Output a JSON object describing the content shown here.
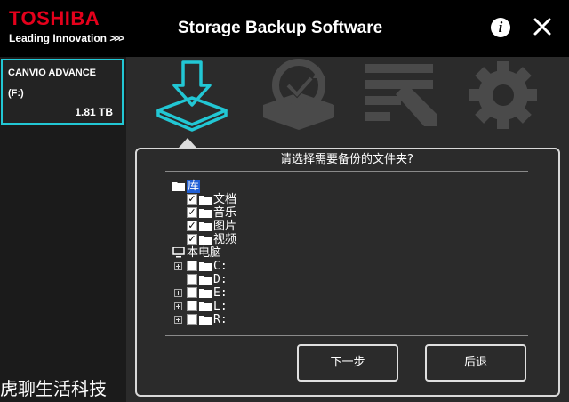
{
  "header": {
    "brand": "TOSHIBA",
    "tagline": "Leading Innovation",
    "tagline_arrows": ">>>",
    "app_title": "Storage Backup Software",
    "info_label": "i"
  },
  "sidebar": {
    "device": {
      "name": "CANVIO ADVANCE",
      "drive": "(F:)",
      "capacity": "1.81 TB"
    }
  },
  "tabs": [
    {
      "name": "backup",
      "icon": "backup-download-icon",
      "active": true
    },
    {
      "name": "restore",
      "icon": "restore-clock-icon",
      "active": false
    },
    {
      "name": "edit",
      "icon": "list-pencil-icon",
      "active": false
    },
    {
      "name": "settings",
      "icon": "gear-icon",
      "active": false
    }
  ],
  "panel": {
    "prompt": "请选择需要备份的文件夹?",
    "tree": {
      "library": {
        "label": "库",
        "children": [
          "文档",
          "音乐",
          "图片",
          "视频"
        ],
        "checked": [
          true,
          true,
          true,
          true
        ]
      },
      "computer": {
        "label": "本电脑",
        "drives": [
          "C:",
          "D:",
          "E:",
          "L:",
          "R:"
        ],
        "expandable": [
          true,
          false,
          true,
          true,
          true
        ]
      }
    },
    "buttons": {
      "next": "下一步",
      "back": "后退"
    }
  },
  "watermark": "虎聊生活科技",
  "colors": {
    "accent": "#22c7d4",
    "brand_red": "#e4001b",
    "inactive_icon": "#4a4a4a"
  }
}
